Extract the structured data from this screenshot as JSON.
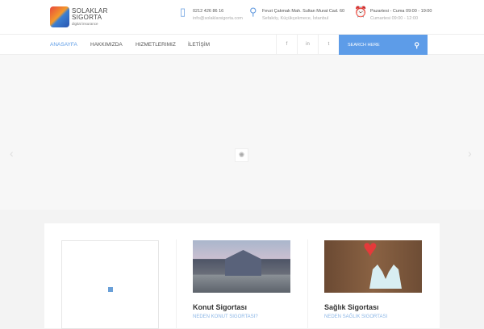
{
  "logo": {
    "line1": "SOLAKLAR",
    "line2": "SIGORTA",
    "tagline": "digital insurance"
  },
  "contact": {
    "phone": "0212 426 86 16",
    "email": "info@solaklarsigorta.com",
    "address1": "Fevzi Çakmak Mah. Sultan Murat Cad. 60",
    "address2": "Sefaköy, Küçükçekmece, İstanbul",
    "hours1": "Pazartesi - Cuma 09:00 - 19:00",
    "hours2": "Cumartesi 09:00 - 12:00"
  },
  "nav": {
    "items": [
      "ANASAYFA",
      "HAKKIMIZDA",
      "HIZMETLERIMIZ",
      "İLETİŞİM"
    ],
    "active": 0,
    "social": [
      "f",
      "in",
      "t"
    ],
    "search_placeholder": "SEARCH HERE"
  },
  "slider": {
    "prev": "‹",
    "next": "›"
  },
  "cards": [
    {
      "title": "Konut Sigortası",
      "link": "NEDEN KONUT SIGORTASI?"
    },
    {
      "title": "Sağlık Sigortası",
      "link": "NEDEN SAĞLIK SIGORTASI"
    }
  ],
  "colors": {
    "accent": "#5d9ce8"
  }
}
